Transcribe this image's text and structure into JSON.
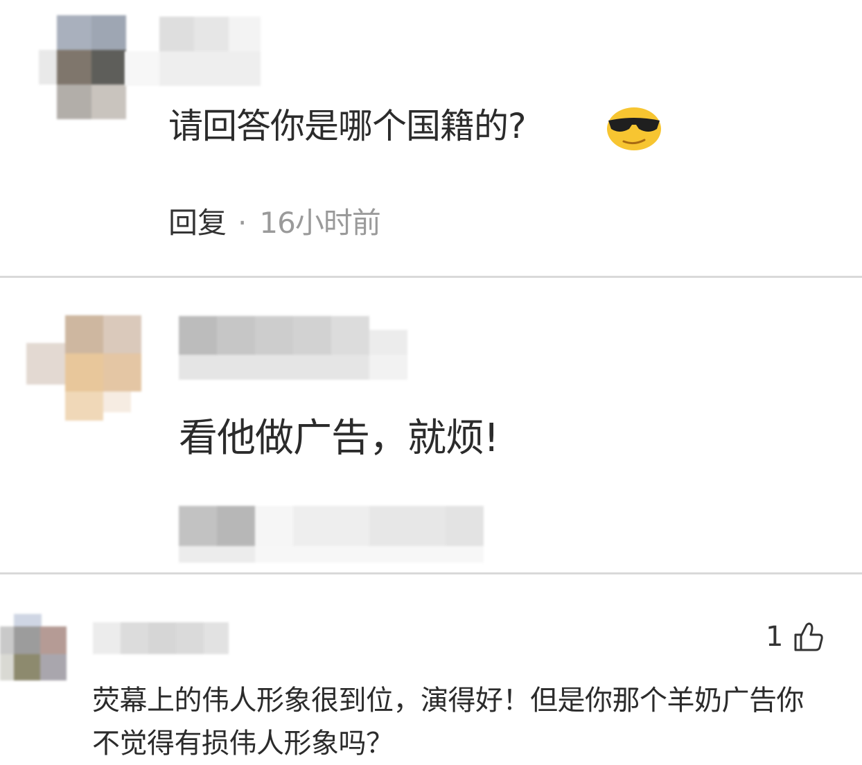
{
  "comments": [
    {
      "text": "请回答你是哪个国籍的?",
      "emoji": "sunglasses-emoji",
      "reply_label": "回复",
      "separator": "·",
      "time": "16小时前"
    },
    {
      "text": "看他做广告，就烦!"
    },
    {
      "text": "荧幕上的伟人形象很到位，演得好！但是你那个羊奶广告你不觉得有损伟人形象吗？",
      "like_count": "1",
      "like_icon": "thumbs-up-icon"
    }
  ],
  "colors": {
    "text": "#2b2b2b",
    "muted": "#9a9a9a",
    "divider": "#d9d9d9",
    "emoji": "#f7c531"
  }
}
